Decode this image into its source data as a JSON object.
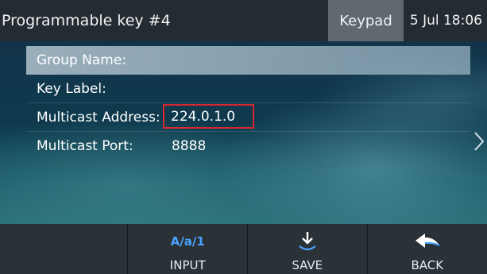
{
  "header": {
    "title": "Programmable key #4",
    "keypad_label": "Keypad",
    "datetime": "5 Jul 18:06"
  },
  "form": {
    "rows": [
      {
        "label": "Group Name:",
        "value": ""
      },
      {
        "label": "Key Label:",
        "value": ""
      },
      {
        "label": "Multicast Address:",
        "value": "224.0.1.0"
      },
      {
        "label": "Multicast Port:",
        "value": "8888"
      }
    ]
  },
  "softkeys": {
    "input": {
      "icon_text": "A/a/1",
      "label": "INPUT"
    },
    "save": {
      "icon": "save-download-icon",
      "label": "SAVE"
    },
    "back": {
      "icon": "back-arrow-icon",
      "label": "BACK"
    }
  },
  "colors": {
    "title_bar": "#242b31",
    "keypad_button": "#60696f",
    "highlight_border": "#d9262f",
    "input_icon": "#4aa3ff",
    "softkey_bar": "#2a3137"
  }
}
